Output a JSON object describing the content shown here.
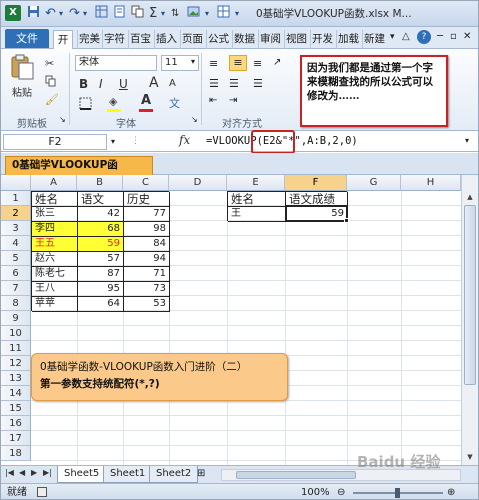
{
  "title": "0基础学VLOOKUP函数.xlsx M...",
  "quick_access": {
    "save_icon": "save-icon",
    "undo": "↶",
    "redo": "↷"
  },
  "window_controls": {
    "min": "─",
    "restore": "▫",
    "close": "✕"
  },
  "tabs": [
    {
      "label": "文件"
    },
    {
      "label": "开始"
    },
    {
      "label": "完美"
    },
    {
      "label": "字符"
    },
    {
      "label": "百宝"
    },
    {
      "label": "插入"
    },
    {
      "label": "页面"
    },
    {
      "label": "公式"
    },
    {
      "label": "数据"
    },
    {
      "label": "审阅"
    },
    {
      "label": "视图"
    },
    {
      "label": "开发"
    },
    {
      "label": "加载"
    },
    {
      "label": "新建"
    }
  ],
  "ribbon": {
    "paste_label": "粘贴",
    "font_name": "宋体",
    "font_size": "11",
    "bold": "B",
    "italic": "I",
    "underline": "U",
    "grow_font": "A",
    "shrink_font": "A",
    "font_color_letter": "A",
    "format_painter": "≡",
    "group_clipboard": "剪贴板",
    "group_font": "字体",
    "group_align": "对齐方式"
  },
  "callout_top": "因为我们都是通过第一个字来模糊查找的所以公式可以修改为……",
  "name_box": "F2",
  "formula_icon": "fx",
  "formula": "=VLOOKUP(E2&\"*\",A:B,2,0)",
  "doc_tab": "0基础学VLOOKUP函数.xlsx",
  "columns": [
    "A",
    "B",
    "C",
    "D",
    "E",
    "F",
    "G",
    "H"
  ],
  "rows": [
    "1",
    "2",
    "3",
    "4",
    "5",
    "6",
    "7",
    "8",
    "9",
    "10",
    "11",
    "12",
    "13",
    "14",
    "15",
    "16",
    "17",
    "18"
  ],
  "table": {
    "headers": [
      "姓名",
      "语文",
      "历史"
    ],
    "rows": [
      {
        "name": "张三",
        "chinese": "42",
        "history": "77"
      },
      {
        "name": "李四",
        "chinese": "68",
        "history": "98"
      },
      {
        "name": "王五",
        "chinese": "59",
        "history": "84"
      },
      {
        "name": "赵六",
        "chinese": "57",
        "history": "94"
      },
      {
        "name": "陈老七",
        "chinese": "87",
        "history": "71"
      },
      {
        "name": "王八",
        "chinese": "95",
        "history": "73"
      },
      {
        "name": "苹苹",
        "chinese": "64",
        "history": "53"
      }
    ]
  },
  "lookup": {
    "header_name": "姓名",
    "header_score": "语文成绩",
    "name": "王",
    "score": "59"
  },
  "callout_bottom": {
    "line1": "0基础学函数-VLOOKUP函数入门进阶（二）",
    "line2": "第一参数支持统配符(*,?)"
  },
  "sheets": [
    "Sheet5",
    "Sheet1",
    "Sheet2"
  ],
  "status": {
    "ready": "就绪",
    "zoom": "100%",
    "watermark": "Baidu 经验"
  },
  "colors": {
    "yellow_fill": "#ffff33",
    "red_text": "#e8291a",
    "callout_fill": "#fbc98a",
    "doc_tab": "#f7b84a"
  }
}
